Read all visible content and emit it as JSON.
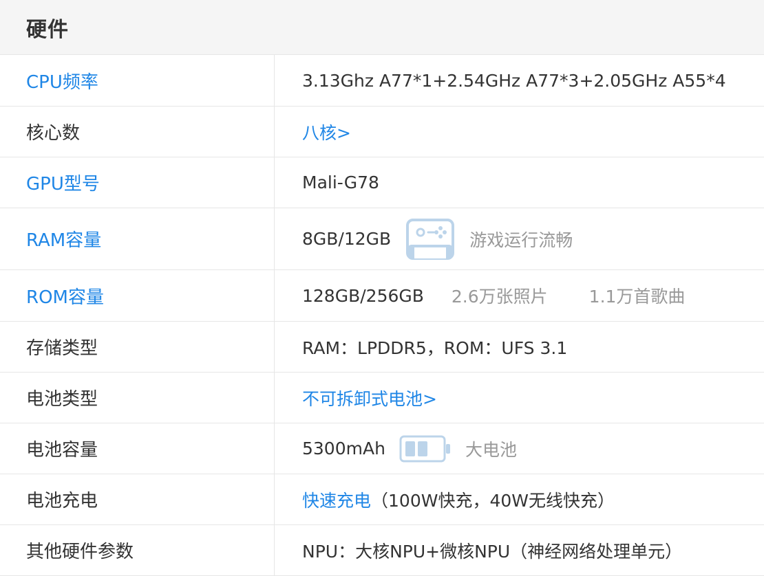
{
  "header": {
    "title": "硬件"
  },
  "rows": [
    {
      "label": "CPU频率",
      "value": "3.13Ghz A77*1+2.54GHz A77*3+2.05GHz A55*4"
    },
    {
      "label": "核心数",
      "value": "八核>"
    },
    {
      "label": "GPU型号",
      "value": "Mali-G78"
    },
    {
      "label": "RAM容量",
      "value": "8GB/12GB",
      "icon": "gamepad-icon",
      "note": "游戏运行流畅"
    },
    {
      "label": "ROM容量",
      "value": "128GB/256GB",
      "note1": "2.6万张照片",
      "note2": "1.1万首歌曲"
    },
    {
      "label": "存储类型",
      "value": "RAM：LPDDR5，ROM：UFS 3.1"
    },
    {
      "label": "电池类型",
      "value": "不可拆卸式电池>"
    },
    {
      "label": "电池容量",
      "value": "5300mAh",
      "icon": "battery-icon",
      "note": "大电池"
    },
    {
      "label": "电池充电",
      "value_link": "快速充电",
      "value_rest": "（100W快充，40W无线快充）"
    },
    {
      "label": "其他硬件参数",
      "value": "NPU：大核NPU+微核NPU（神经网络处理单元）"
    }
  ],
  "colors": {
    "link": "#1f86e6",
    "text": "#333333",
    "muted": "#999999",
    "border": "#e6e6e6",
    "header_bg": "#f5f5f5",
    "icon": "#bcd4ea"
  }
}
